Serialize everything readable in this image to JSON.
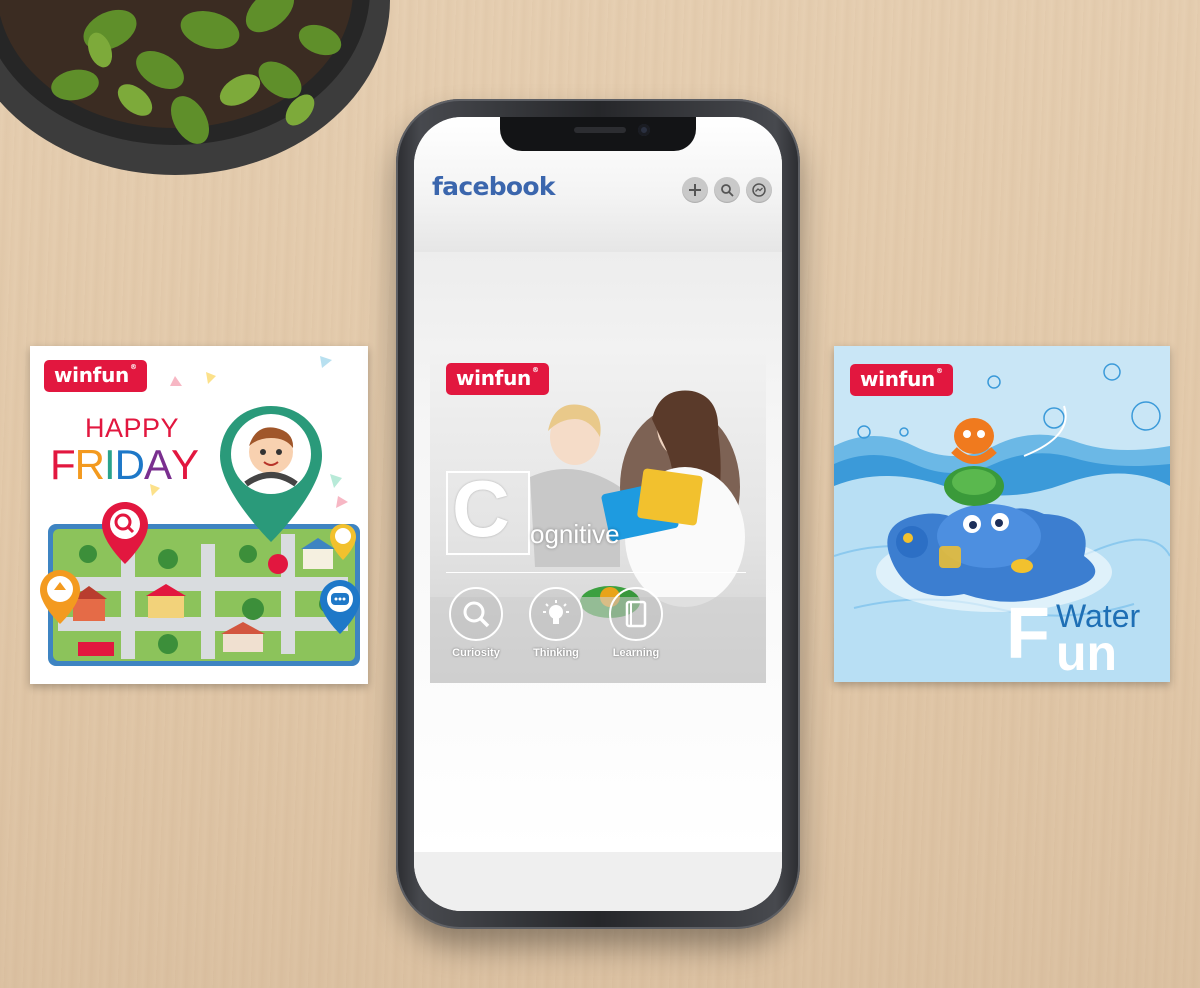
{
  "brand": {
    "logo_text": "winfun",
    "logo_mark": "®"
  },
  "left_card": {
    "line1": "HAPPY",
    "line2_letters": [
      "F",
      "R",
      "I",
      "D",
      "A",
      "Y"
    ],
    "line2_colors": [
      "#e2173f",
      "#f39a1f",
      "#2aa38b",
      "#1e78c8",
      "#7a2f8f",
      "#e2173f"
    ]
  },
  "phone": {
    "app_title": "facebook",
    "header_icons": [
      "plus-icon",
      "search-icon",
      "messenger-icon"
    ],
    "post": {
      "headline_initial": "C",
      "headline_rest": "ognitive",
      "skills": [
        {
          "label": "Curiosity",
          "icon": "search-icon"
        },
        {
          "label": "Thinking",
          "icon": "lightbulb-icon"
        },
        {
          "label": "Learning",
          "icon": "book-icon"
        }
      ]
    }
  },
  "right_card": {
    "word1": "Water",
    "word2_initial": "F",
    "word2_rest": "un"
  },
  "colors": {
    "brand_red": "#e2173f",
    "facebook_blue": "#3b66ad",
    "water_blue": "#1e6fb5"
  }
}
